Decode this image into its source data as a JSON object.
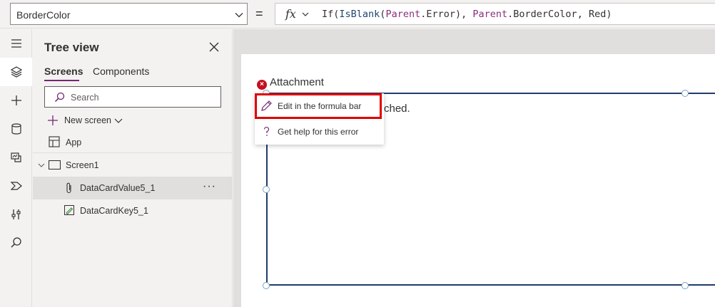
{
  "formula_bar": {
    "property": "BorderColor",
    "equals": "=",
    "fx_label": "fx",
    "formula": {
      "p1": "If(",
      "p2": "IsBlank",
      "p3": "(",
      "p4": "Parent",
      "p5": ".Error), ",
      "p6": "Parent",
      "p7": ".BorderColor, Red)"
    }
  },
  "rail": {
    "items": [
      "menu-icon",
      "layers-icon",
      "add-icon",
      "database-icon",
      "media-icon",
      "power-automate-icon",
      "tools-icon",
      "search-icon"
    ],
    "active": "layers-icon"
  },
  "tree": {
    "title": "Tree view",
    "tabs": [
      "Screens",
      "Components"
    ],
    "active_tab": "Screens",
    "search_placeholder": "Search",
    "new_screen": "New screen",
    "app_label": "App",
    "screen1": "Screen1",
    "dcv": "DataCardValue5_1",
    "dck": "DataCardKey5_1",
    "more": "···"
  },
  "canvas": {
    "attachment_label": "Attachment",
    "no_file_text": "ched.",
    "error_badge": "×"
  },
  "context_menu": {
    "edit": "Edit in the formula bar",
    "help": "Get help for this error"
  },
  "colors": {
    "accent": "#742774",
    "error": "#c50f1f",
    "highlight": "#e00000",
    "border": "#203c68"
  }
}
